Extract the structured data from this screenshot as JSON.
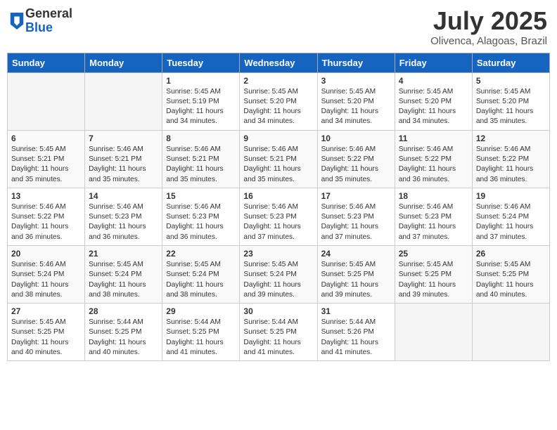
{
  "header": {
    "logo_general": "General",
    "logo_blue": "Blue",
    "title": "July 2025",
    "location": "Olivenca, Alagoas, Brazil"
  },
  "weekdays": [
    "Sunday",
    "Monday",
    "Tuesday",
    "Wednesday",
    "Thursday",
    "Friday",
    "Saturday"
  ],
  "weeks": [
    [
      {
        "day": "",
        "empty": true
      },
      {
        "day": "",
        "empty": true
      },
      {
        "day": "1",
        "sunrise": "Sunrise: 5:45 AM",
        "sunset": "Sunset: 5:19 PM",
        "daylight": "Daylight: 11 hours and 34 minutes."
      },
      {
        "day": "2",
        "sunrise": "Sunrise: 5:45 AM",
        "sunset": "Sunset: 5:20 PM",
        "daylight": "Daylight: 11 hours and 34 minutes."
      },
      {
        "day": "3",
        "sunrise": "Sunrise: 5:45 AM",
        "sunset": "Sunset: 5:20 PM",
        "daylight": "Daylight: 11 hours and 34 minutes."
      },
      {
        "day": "4",
        "sunrise": "Sunrise: 5:45 AM",
        "sunset": "Sunset: 5:20 PM",
        "daylight": "Daylight: 11 hours and 34 minutes."
      },
      {
        "day": "5",
        "sunrise": "Sunrise: 5:45 AM",
        "sunset": "Sunset: 5:20 PM",
        "daylight": "Daylight: 11 hours and 35 minutes."
      }
    ],
    [
      {
        "day": "6",
        "sunrise": "Sunrise: 5:45 AM",
        "sunset": "Sunset: 5:21 PM",
        "daylight": "Daylight: 11 hours and 35 minutes."
      },
      {
        "day": "7",
        "sunrise": "Sunrise: 5:46 AM",
        "sunset": "Sunset: 5:21 PM",
        "daylight": "Daylight: 11 hours and 35 minutes."
      },
      {
        "day": "8",
        "sunrise": "Sunrise: 5:46 AM",
        "sunset": "Sunset: 5:21 PM",
        "daylight": "Daylight: 11 hours and 35 minutes."
      },
      {
        "day": "9",
        "sunrise": "Sunrise: 5:46 AM",
        "sunset": "Sunset: 5:21 PM",
        "daylight": "Daylight: 11 hours and 35 minutes."
      },
      {
        "day": "10",
        "sunrise": "Sunrise: 5:46 AM",
        "sunset": "Sunset: 5:22 PM",
        "daylight": "Daylight: 11 hours and 35 minutes."
      },
      {
        "day": "11",
        "sunrise": "Sunrise: 5:46 AM",
        "sunset": "Sunset: 5:22 PM",
        "daylight": "Daylight: 11 hours and 36 minutes."
      },
      {
        "day": "12",
        "sunrise": "Sunrise: 5:46 AM",
        "sunset": "Sunset: 5:22 PM",
        "daylight": "Daylight: 11 hours and 36 minutes."
      }
    ],
    [
      {
        "day": "13",
        "sunrise": "Sunrise: 5:46 AM",
        "sunset": "Sunset: 5:22 PM",
        "daylight": "Daylight: 11 hours and 36 minutes."
      },
      {
        "day": "14",
        "sunrise": "Sunrise: 5:46 AM",
        "sunset": "Sunset: 5:23 PM",
        "daylight": "Daylight: 11 hours and 36 minutes."
      },
      {
        "day": "15",
        "sunrise": "Sunrise: 5:46 AM",
        "sunset": "Sunset: 5:23 PM",
        "daylight": "Daylight: 11 hours and 36 minutes."
      },
      {
        "day": "16",
        "sunrise": "Sunrise: 5:46 AM",
        "sunset": "Sunset: 5:23 PM",
        "daylight": "Daylight: 11 hours and 37 minutes."
      },
      {
        "day": "17",
        "sunrise": "Sunrise: 5:46 AM",
        "sunset": "Sunset: 5:23 PM",
        "daylight": "Daylight: 11 hours and 37 minutes."
      },
      {
        "day": "18",
        "sunrise": "Sunrise: 5:46 AM",
        "sunset": "Sunset: 5:23 PM",
        "daylight": "Daylight: 11 hours and 37 minutes."
      },
      {
        "day": "19",
        "sunrise": "Sunrise: 5:46 AM",
        "sunset": "Sunset: 5:24 PM",
        "daylight": "Daylight: 11 hours and 37 minutes."
      }
    ],
    [
      {
        "day": "20",
        "sunrise": "Sunrise: 5:46 AM",
        "sunset": "Sunset: 5:24 PM",
        "daylight": "Daylight: 11 hours and 38 minutes."
      },
      {
        "day": "21",
        "sunrise": "Sunrise: 5:45 AM",
        "sunset": "Sunset: 5:24 PM",
        "daylight": "Daylight: 11 hours and 38 minutes."
      },
      {
        "day": "22",
        "sunrise": "Sunrise: 5:45 AM",
        "sunset": "Sunset: 5:24 PM",
        "daylight": "Daylight: 11 hours and 38 minutes."
      },
      {
        "day": "23",
        "sunrise": "Sunrise: 5:45 AM",
        "sunset": "Sunset: 5:24 PM",
        "daylight": "Daylight: 11 hours and 39 minutes."
      },
      {
        "day": "24",
        "sunrise": "Sunrise: 5:45 AM",
        "sunset": "Sunset: 5:25 PM",
        "daylight": "Daylight: 11 hours and 39 minutes."
      },
      {
        "day": "25",
        "sunrise": "Sunrise: 5:45 AM",
        "sunset": "Sunset: 5:25 PM",
        "daylight": "Daylight: 11 hours and 39 minutes."
      },
      {
        "day": "26",
        "sunrise": "Sunrise: 5:45 AM",
        "sunset": "Sunset: 5:25 PM",
        "daylight": "Daylight: 11 hours and 40 minutes."
      }
    ],
    [
      {
        "day": "27",
        "sunrise": "Sunrise: 5:45 AM",
        "sunset": "Sunset: 5:25 PM",
        "daylight": "Daylight: 11 hours and 40 minutes."
      },
      {
        "day": "28",
        "sunrise": "Sunrise: 5:44 AM",
        "sunset": "Sunset: 5:25 PM",
        "daylight": "Daylight: 11 hours and 40 minutes."
      },
      {
        "day": "29",
        "sunrise": "Sunrise: 5:44 AM",
        "sunset": "Sunset: 5:25 PM",
        "daylight": "Daylight: 11 hours and 41 minutes."
      },
      {
        "day": "30",
        "sunrise": "Sunrise: 5:44 AM",
        "sunset": "Sunset: 5:25 PM",
        "daylight": "Daylight: 11 hours and 41 minutes."
      },
      {
        "day": "31",
        "sunrise": "Sunrise: 5:44 AM",
        "sunset": "Sunset: 5:26 PM",
        "daylight": "Daylight: 11 hours and 41 minutes."
      },
      {
        "day": "",
        "empty": true
      },
      {
        "day": "",
        "empty": true
      }
    ]
  ]
}
